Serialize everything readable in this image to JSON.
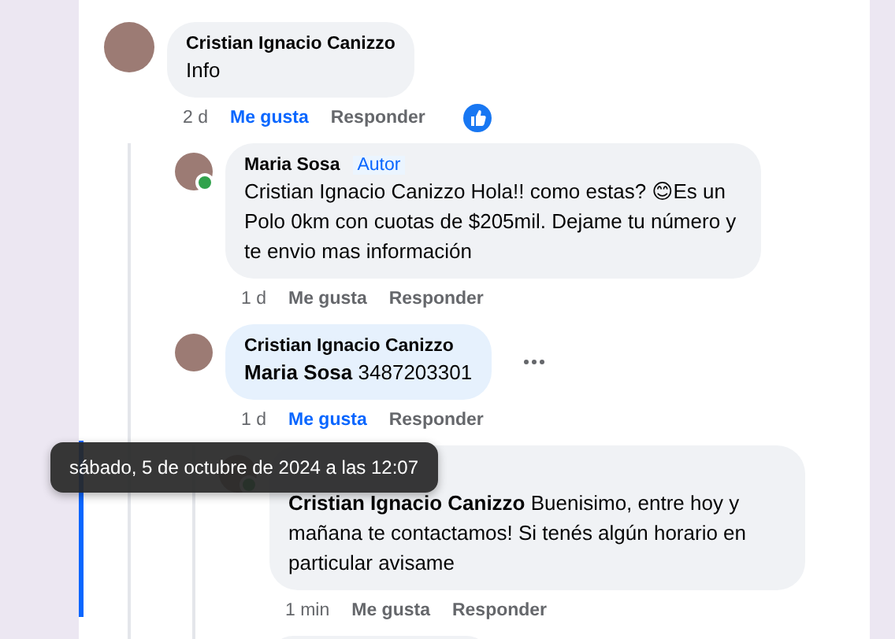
{
  "comments": [
    {
      "author": "Cristian Ignacio Canizzo",
      "text": "Info",
      "time": "2 d",
      "like_label": "Me gusta",
      "liked": true,
      "reply_label": "Responder",
      "reacted": true,
      "children": [
        {
          "author": "Maria Sosa",
          "badge": "Autor",
          "online": true,
          "text": "Cristian Ignacio Canizzo Hola!! como estas? 😊Es un Polo 0km con cuotas de $205mil. Dejame tu número y te envio mas información",
          "time": "1 d",
          "like_label": "Me gusta",
          "liked": false,
          "reply_label": "Responder"
        },
        {
          "author": "Cristian Ignacio Canizzo",
          "text": "**Maria Sosa** 3487203301",
          "time": "1 d",
          "like_label": "Me gusta",
          "liked": true,
          "reply_label": "Responder",
          "more_menu": true,
          "children": [
            {
              "online": true,
              "text": "**Cristian Ignacio Canizzo** Buenisimo, entre hoy y mañana te contactamos! Si tenés algún horario en particular avisame",
              "time": "1 min",
              "like_label": "Me gusta",
              "liked": false,
              "reply_label": "Responder"
            },
            {
              "cut": true
            }
          ]
        }
      ]
    }
  ],
  "tooltip": "sábado, 5 de octubre de 2024 a las 12:07"
}
